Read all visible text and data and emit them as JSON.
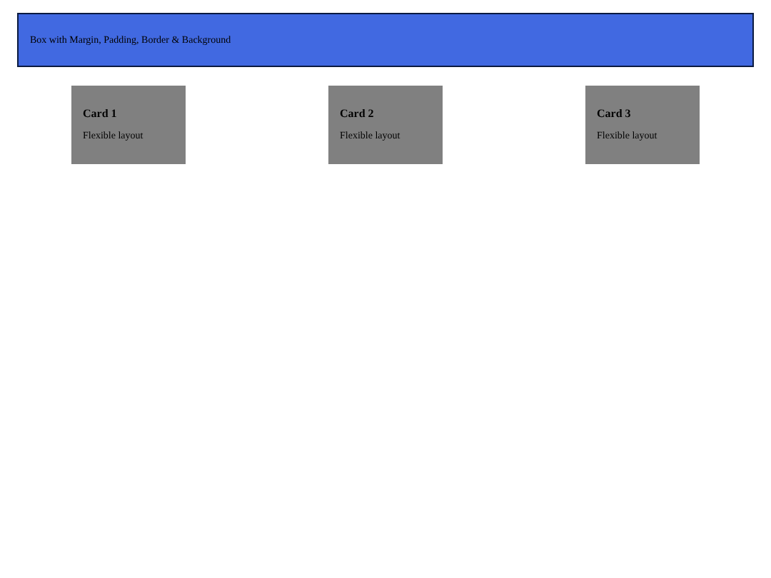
{
  "box": {
    "text": "Box with Margin, Padding, Border & Background"
  },
  "cards": [
    {
      "title": "Card 1",
      "text": "Flexible layout"
    },
    {
      "title": "Card 2",
      "text": "Flexible layout"
    },
    {
      "title": "Card 3",
      "text": "Flexible layout"
    }
  ]
}
